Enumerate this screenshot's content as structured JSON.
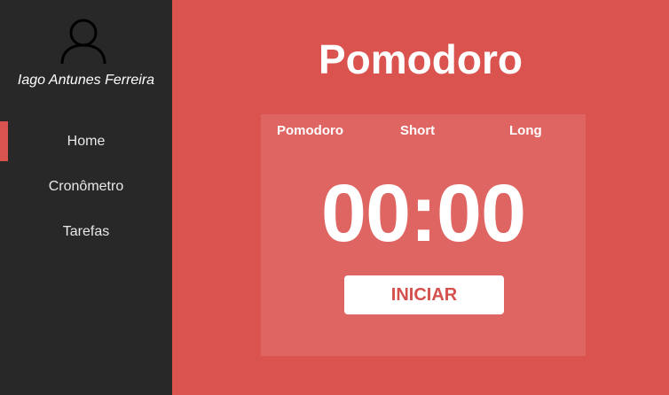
{
  "sidebar": {
    "user": {
      "name": "Iago Antunes Ferreira",
      "avatar_icon": "user-icon"
    },
    "items": [
      {
        "label": "Home",
        "active": true
      },
      {
        "label": "Cronômetro",
        "active": false
      },
      {
        "label": "Tarefas",
        "active": false
      }
    ]
  },
  "main": {
    "title": "Pomodoro",
    "tabs": [
      {
        "label": "Pomodoro"
      },
      {
        "label": "Short"
      },
      {
        "label": "Long"
      }
    ],
    "timer": "00:00",
    "start_label": "INICIAR"
  },
  "colors": {
    "background": "#da534f",
    "sidebar": "#292829",
    "card": "#df6562",
    "button_text": "#d4504c"
  }
}
